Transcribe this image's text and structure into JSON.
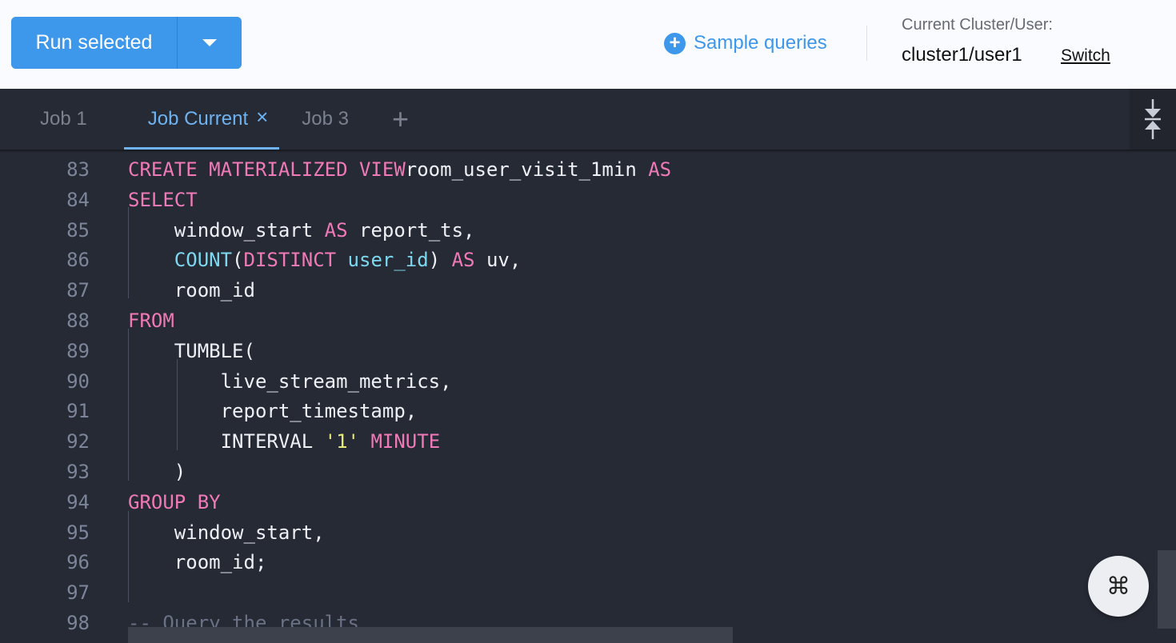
{
  "toolbar": {
    "run_label": "Run selected",
    "sample_queries_label": "Sample queries",
    "cluster_label": "Current Cluster/User:",
    "cluster_value": "cluster1/user1",
    "switch_label": "Switch"
  },
  "tabs": [
    {
      "label": "Job 1",
      "active": false
    },
    {
      "label": "Job Current",
      "active": true
    },
    {
      "label": "Job 3",
      "active": false
    }
  ],
  "tab_close_glyph": "×",
  "tab_add_glyph": "+",
  "shortcut_glyph": "⌘",
  "colors": {
    "accent": "#3d97ea",
    "keyword": "#f07ab8",
    "identifier": "#7dd9f0",
    "string": "#e7e87a",
    "editor_bg": "#262a35"
  },
  "editor": {
    "lines": [
      {
        "n": "83",
        "tokens": [
          [
            "kw",
            "CREATE MATERIALIZED VIEW"
          ],
          [
            "",
            "room_user_visit_1min "
          ],
          [
            "kw",
            "AS"
          ]
        ]
      },
      {
        "n": "84",
        "tokens": [
          [
            "kw",
            "SELECT"
          ]
        ]
      },
      {
        "n": "85",
        "tokens": [
          [
            "",
            "    window_start "
          ],
          [
            "kw",
            "AS"
          ],
          [
            "",
            " report_ts,"
          ]
        ]
      },
      {
        "n": "86",
        "tokens": [
          [
            "fn",
            "    COUNT"
          ],
          [
            "",
            "("
          ],
          [
            "kw",
            "DISTINCT"
          ],
          [
            "",
            " "
          ],
          [
            "id",
            "user_id"
          ],
          [
            "",
            ") "
          ],
          [
            "kw",
            "AS"
          ],
          [
            "",
            " uv,"
          ]
        ]
      },
      {
        "n": "87",
        "tokens": [
          [
            "",
            "    room_id"
          ]
        ]
      },
      {
        "n": "88",
        "tokens": [
          [
            "kw",
            "FROM"
          ]
        ]
      },
      {
        "n": "89",
        "tokens": [
          [
            "",
            "    TUMBLE("
          ]
        ]
      },
      {
        "n": "90",
        "tokens": [
          [
            "",
            "        live_stream_metrics,"
          ]
        ]
      },
      {
        "n": "91",
        "tokens": [
          [
            "",
            "        report_timestamp,"
          ]
        ]
      },
      {
        "n": "92",
        "tokens": [
          [
            "",
            "        INTERVAL "
          ],
          [
            "str",
            "'1'"
          ],
          [
            "",
            " "
          ],
          [
            "kw",
            "MINUTE"
          ]
        ]
      },
      {
        "n": "93",
        "tokens": [
          [
            "",
            "    )"
          ]
        ]
      },
      {
        "n": "94",
        "tokens": [
          [
            "kw",
            "GROUP BY"
          ]
        ]
      },
      {
        "n": "95",
        "tokens": [
          [
            "",
            "    window_start,"
          ]
        ]
      },
      {
        "n": "96",
        "tokens": [
          [
            "",
            "    room_id;"
          ]
        ]
      },
      {
        "n": "97",
        "tokens": []
      },
      {
        "n": "98",
        "tokens": [
          [
            "cm",
            "-- Query the results"
          ]
        ]
      }
    ]
  }
}
